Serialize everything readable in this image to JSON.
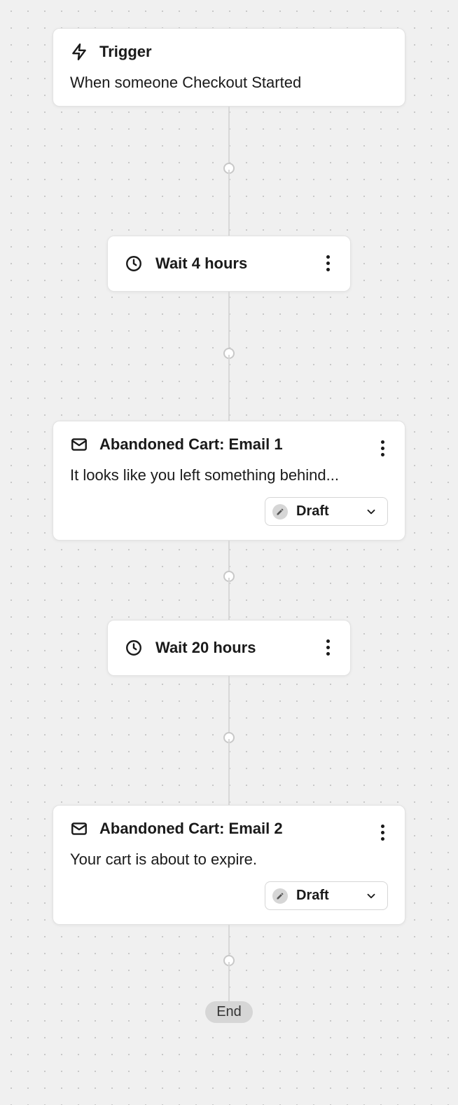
{
  "trigger": {
    "title": "Trigger",
    "description": "When someone Checkout Started"
  },
  "steps": {
    "wait1": {
      "label": "Wait 4 hours"
    },
    "email1": {
      "title": "Abandoned Cart: Email 1",
      "subject": "It looks like you left something behind...",
      "status": "Draft"
    },
    "wait2": {
      "label": "Wait 20 hours"
    },
    "email2": {
      "title": "Abandoned Cart: Email 2",
      "subject": "Your cart is about to expire.",
      "status": "Draft"
    }
  },
  "end": {
    "label": "End"
  }
}
